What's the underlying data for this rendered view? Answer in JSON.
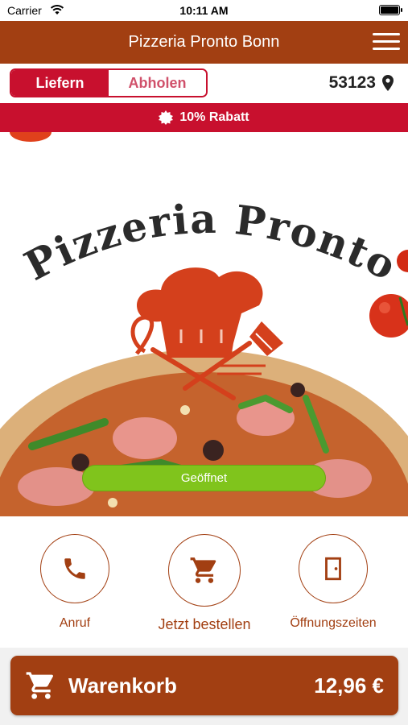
{
  "status_bar": {
    "carrier": "Carrier",
    "time": "10:11 AM"
  },
  "header": {
    "title": "Pizzeria Pronto Bonn"
  },
  "delivery": {
    "modes": [
      "Liefern",
      "Abholen"
    ],
    "selected": "Liefern",
    "zip": "53123"
  },
  "promo": {
    "text": "10% Rabatt"
  },
  "hero": {
    "logo_text": "Pizzeria Pronto",
    "status": "Geöffnet"
  },
  "actions": [
    {
      "label": "Anruf",
      "icon": "phone-icon"
    },
    {
      "label": "Jetzt bestellen",
      "icon": "cart-icon"
    },
    {
      "label": "Öffnungszeiten",
      "icon": "door-icon"
    }
  ],
  "cart": {
    "label": "Warenkorb",
    "total": "12,96 €"
  },
  "colors": {
    "brand": "#a23f12",
    "accent": "#c8102e",
    "open": "#80c41c"
  }
}
